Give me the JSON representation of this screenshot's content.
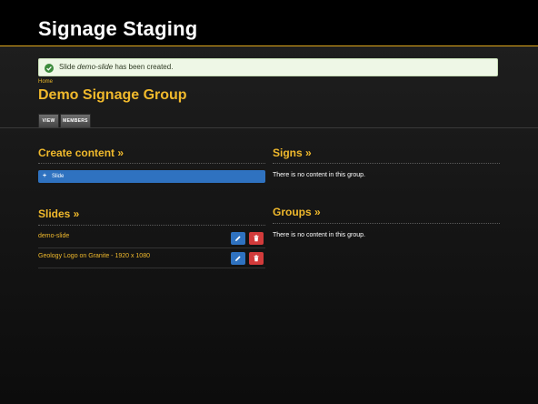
{
  "header": {
    "site_title": "Signage Staging"
  },
  "alert": {
    "prefix": "Slide ",
    "slide_name": "demo-slide",
    "suffix": " has been created."
  },
  "breadcrumb": {
    "home": "Home"
  },
  "page": {
    "title": "Demo Signage Group"
  },
  "tabs": [
    {
      "label": "VIEW"
    },
    {
      "label": "MEMBERS"
    }
  ],
  "create_content": {
    "heading": "Create content »",
    "slide_button": "Slide"
  },
  "slides": {
    "heading": "Slides »",
    "items": [
      {
        "title": "demo-slide"
      },
      {
        "title": "Geology Logo on Granite - 1920 x 1080"
      }
    ]
  },
  "signs": {
    "heading": "Signs »",
    "empty": "There is no content in this group."
  },
  "groups": {
    "heading": "Groups »",
    "empty": "There is no content in this group."
  },
  "colors": {
    "accent": "#f0b92c",
    "primary": "#2f72c0",
    "danger": "#d23b3b",
    "success": "#3d8b3d"
  },
  "icons": {
    "alert": "check-circle-icon",
    "edit": "pencil-icon",
    "delete": "trash-icon",
    "add": "plus-icon"
  }
}
